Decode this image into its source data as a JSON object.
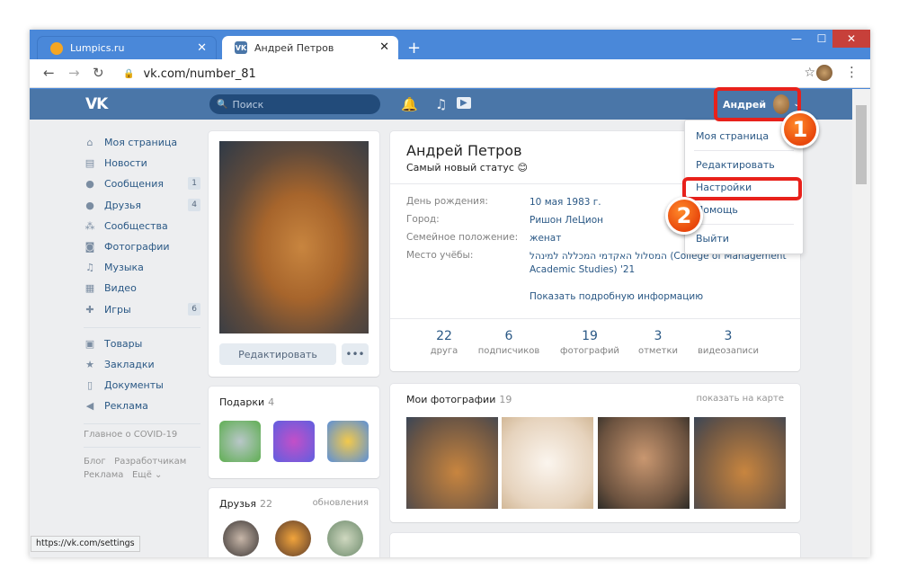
{
  "browser": {
    "tabs": [
      {
        "title": "Lumpics.ru"
      },
      {
        "title": "Андрей Петров"
      }
    ],
    "url": "vk.com/number_81",
    "status_url": "https://vk.com/settings"
  },
  "vk_header": {
    "logo": "VK",
    "search_placeholder": "Поиск",
    "user_name": "Андрей"
  },
  "left_nav": {
    "items": [
      {
        "label": "Моя страница",
        "icon": "home-icon"
      },
      {
        "label": "Новости",
        "icon": "news-icon"
      },
      {
        "label": "Сообщения",
        "icon": "chat-icon",
        "count": "1"
      },
      {
        "label": "Друзья",
        "icon": "friends-icon",
        "count": "4"
      },
      {
        "label": "Сообщества",
        "icon": "groups-icon"
      },
      {
        "label": "Фотографии",
        "icon": "camera-icon"
      },
      {
        "label": "Музыка",
        "icon": "music-icon"
      },
      {
        "label": "Видео",
        "icon": "video-icon"
      },
      {
        "label": "Игры",
        "icon": "gamepad-icon",
        "count": "6"
      }
    ],
    "items2": [
      {
        "label": "Товары",
        "icon": "bag-icon"
      },
      {
        "label": "Закладки",
        "icon": "star-icon"
      },
      {
        "label": "Документы",
        "icon": "document-icon"
      },
      {
        "label": "Реклама",
        "icon": "megaphone-icon"
      }
    ],
    "covid": "Главное о COVID-19",
    "footer1": [
      "Блог",
      "Разработчикам"
    ],
    "footer2": [
      "Реклама",
      "Ещё ⌄"
    ]
  },
  "profile": {
    "edit_label": "Редактировать",
    "more_label": "•••",
    "gifts_title": "Подарки",
    "gifts_count": "4",
    "friends_title": "Друзья",
    "friends_count": "22",
    "friends_updates": "обновления",
    "name": "Андрей Петров",
    "status": "Самый новый статус 😊",
    "info": [
      {
        "label": "День рождения:",
        "value": "10 мая 1983 г."
      },
      {
        "label": "Город:",
        "value": "Ришон ЛеЦион"
      },
      {
        "label": "Семейное положение:",
        "value": "женат"
      },
      {
        "label": "Место учёбы:",
        "value": "המסלול האקדמי המכללה למינהל (College of Management Academic Studies) '21"
      }
    ],
    "show_more": "Показать подробную информацию",
    "counters": [
      {
        "num": "22",
        "label": "друга"
      },
      {
        "num": "6",
        "label": "подписчиков"
      },
      {
        "num": "19",
        "label": "фотографий"
      },
      {
        "num": "3",
        "label": "отметки"
      },
      {
        "num": "3",
        "label": "видеозаписи"
      }
    ],
    "photos_title": "Мои фотографии",
    "photos_count": "19",
    "photos_map": "показать на карте"
  },
  "dropdown": {
    "items": [
      "Моя страница",
      "Редактировать",
      "Настройки",
      "Помощь",
      "Выйти"
    ]
  },
  "callouts": [
    "1",
    "2"
  ],
  "colors": {
    "vk_blue": "#4a76a8",
    "link": "#2a5885",
    "highlight": "#e8211b",
    "badge": "#e8470c"
  }
}
